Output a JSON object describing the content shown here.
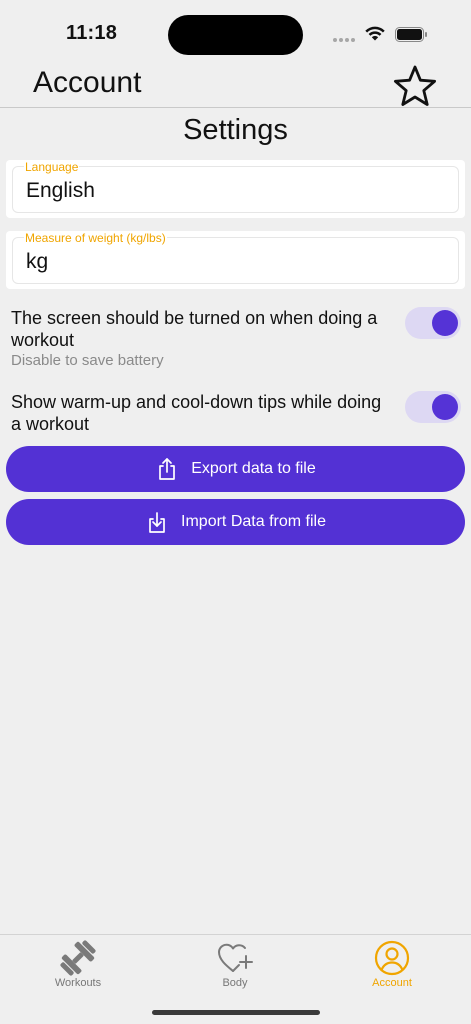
{
  "status_bar": {
    "time": "11:18"
  },
  "header": {
    "title": "Account",
    "star_icon": "star-icon"
  },
  "settings": {
    "title": "Settings",
    "language": {
      "label": "Language",
      "value": "English"
    },
    "weight": {
      "label": "Measure of weight (kg/lbs)",
      "value": "kg"
    },
    "screen_on": {
      "text": "The screen should be turned on when doing a workout",
      "subtext": "Disable to save battery",
      "enabled": true
    },
    "tips": {
      "text": "Show warm-up and cool-down tips while doing a workout",
      "enabled": true
    },
    "export_label": "Export data to file",
    "import_label": "Import Data from file"
  },
  "tabs": [
    {
      "label": "Workouts",
      "icon": "dumbbell-icon",
      "active": false
    },
    {
      "label": "Body",
      "icon": "heart-plus-icon",
      "active": false
    },
    {
      "label": "Account",
      "icon": "account-icon",
      "active": true
    }
  ],
  "colors": {
    "accent": "#5331d4",
    "active_tab": "#f0a500",
    "toggle_track": "#ddd8f3"
  }
}
